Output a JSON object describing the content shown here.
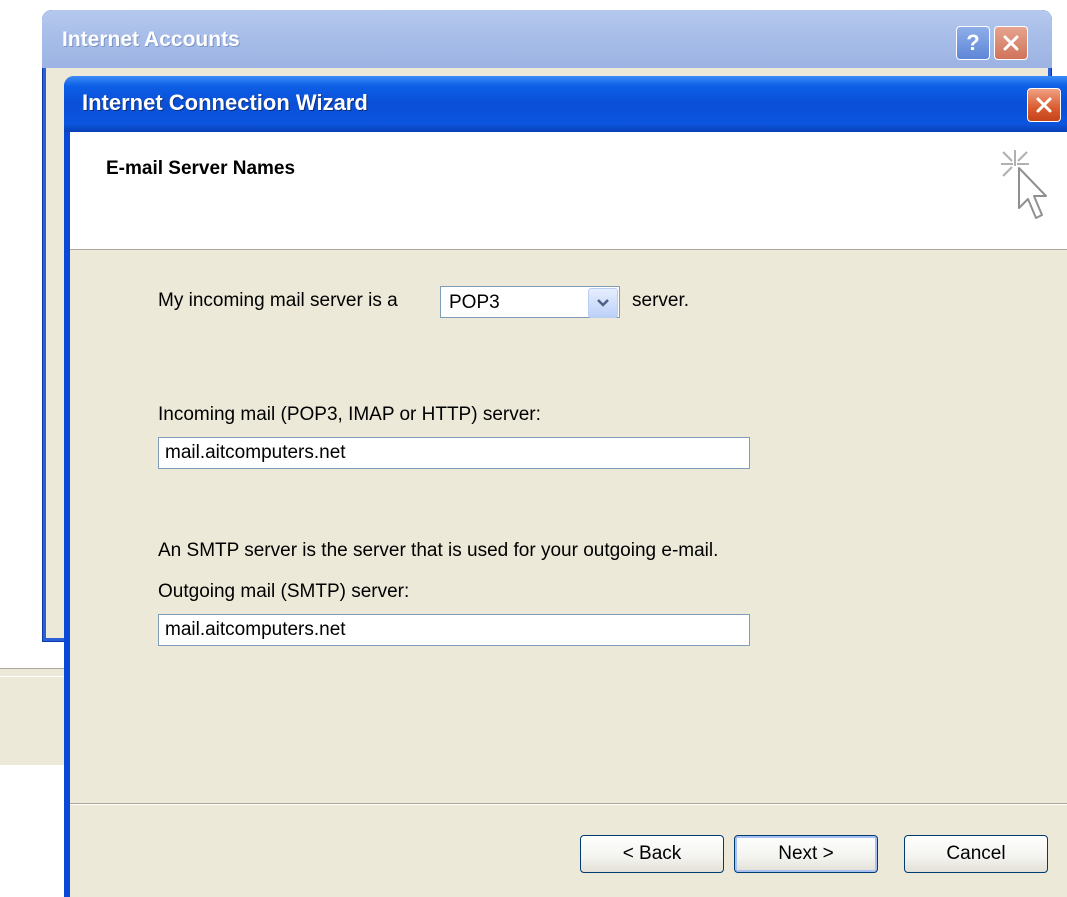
{
  "background_window": {
    "title": "Internet Accounts",
    "help_label": "?"
  },
  "wizard": {
    "title": "Internet Connection Wizard",
    "heading": "E-mail Server Names",
    "server_type_prefix": "My incoming mail server is a",
    "server_type_value": "POP3",
    "server_type_suffix": "server.",
    "incoming_label": "Incoming mail (POP3, IMAP or HTTP) server:",
    "incoming_value": "mail.aitcomputers.net",
    "smtp_info": "An SMTP server is the server that is used for your outgoing e-mail.",
    "outgoing_label": "Outgoing mail (SMTP) server:",
    "outgoing_value": "mail.aitcomputers.net",
    "buttons": {
      "back": "< Back",
      "next": "Next >",
      "cancel": "Cancel"
    }
  },
  "icons": {
    "close": "close-icon",
    "help": "help-icon",
    "dropdown": "chevron-down-icon",
    "wizard_graphic": "sparkle-cursor-icon"
  }
}
